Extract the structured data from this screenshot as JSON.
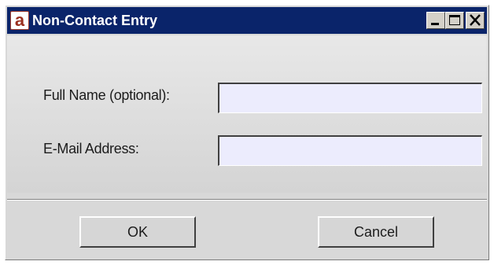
{
  "window": {
    "title": "Non-Contact Entry",
    "app_icon_glyph": "a",
    "app_icon": "app-logo-icon",
    "controls": {
      "minimize_icon": "minimize-icon",
      "maximize_icon": "maximize-icon",
      "close_icon": "close-icon"
    },
    "colors": {
      "titlebar": "#0a246a",
      "field_background": "#ececfd",
      "dialog_background": "#d8d8d8"
    }
  },
  "form": {
    "full_name_label": "Full Name (optional):",
    "full_name_value": "",
    "email_label": "E-Mail Address:",
    "email_value": ""
  },
  "buttons": {
    "ok_label": "OK",
    "cancel_label": "Cancel"
  }
}
